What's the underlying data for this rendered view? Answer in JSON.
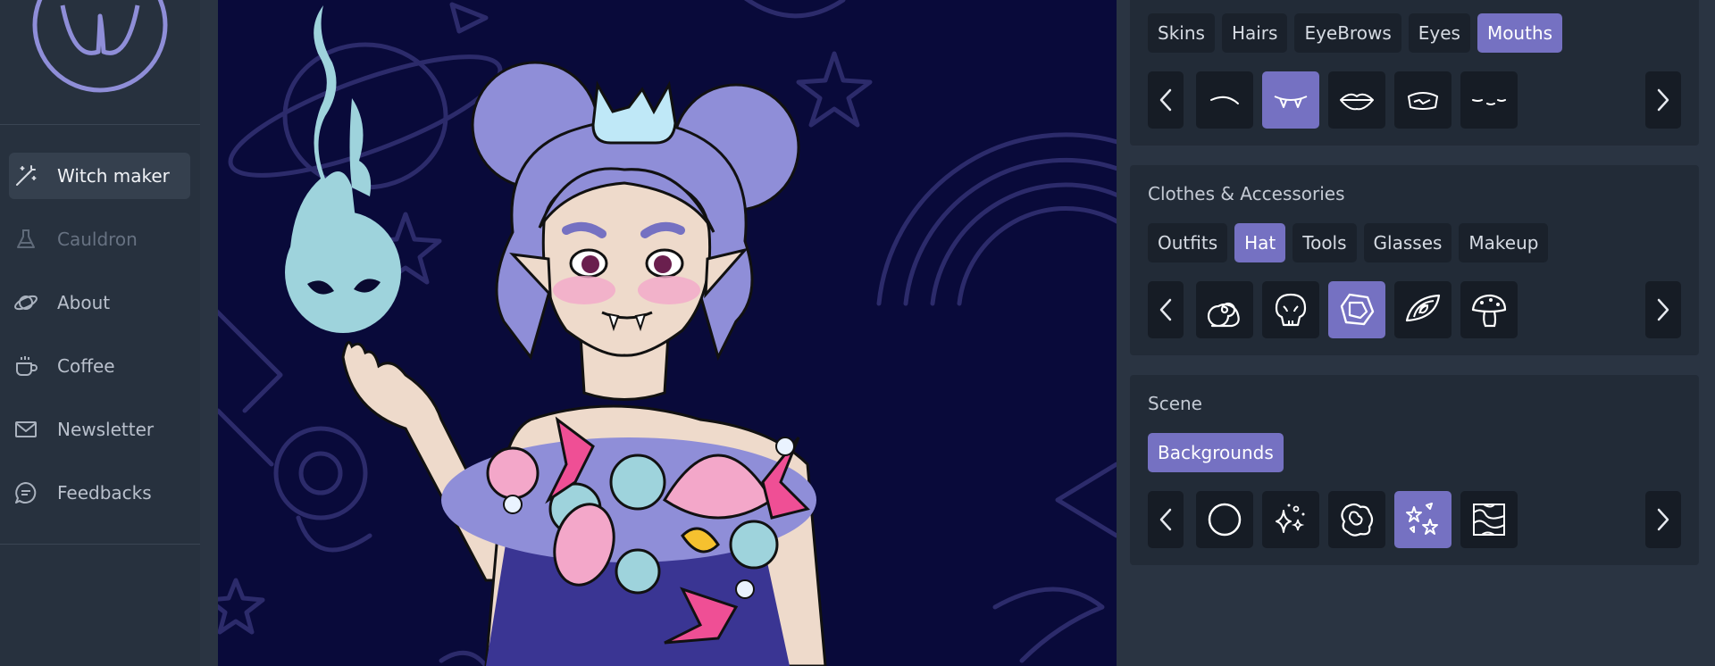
{
  "sidebar": {
    "items": [
      {
        "label": "Witch maker",
        "icon": "magic-wand-icon",
        "state": "active"
      },
      {
        "label": "Cauldron",
        "icon": "flask-icon",
        "state": "disabled"
      },
      {
        "label": "About",
        "icon": "planet-icon",
        "state": "normal"
      },
      {
        "label": "Coffee",
        "icon": "coffee-cup-icon",
        "state": "normal"
      },
      {
        "label": "Newsletter",
        "icon": "envelope-icon",
        "state": "normal"
      },
      {
        "label": "Feedbacks",
        "icon": "chat-bubble-icon",
        "state": "normal"
      }
    ]
  },
  "face": {
    "tabs": [
      "Skins",
      "Hairs",
      "EyeBrows",
      "Eyes",
      "Mouths"
    ],
    "active_tab": "Mouths",
    "items": [
      "mouth-smile-icon",
      "mouth-fangs-icon",
      "mouth-lips-icon",
      "mouth-open-icon",
      "mouth-smirk-icon"
    ],
    "selected_item": "mouth-fangs-icon"
  },
  "clothes": {
    "title": "Clothes & Accessories",
    "tabs": [
      "Outfits",
      "Hat",
      "Tools",
      "Glasses",
      "Makeup"
    ],
    "active_tab": "Hat",
    "items": [
      "snail-shell-icon",
      "skull-icon",
      "crystal-gem-icon",
      "eye-leaf-icon",
      "mushroom-icon"
    ],
    "selected_item": "crystal-gem-icon"
  },
  "scene": {
    "title": "Scene",
    "tabs": [
      "Backgrounds"
    ],
    "active_tab": "Backgrounds",
    "items": [
      "circle-icon",
      "sparkles-icon",
      "blob-icon",
      "stars-icon",
      "waves-icon"
    ],
    "selected_item": "stars-icon"
  },
  "colors": {
    "accent": "#7571c2",
    "canvas": "#090a3a",
    "hair": "#8f8ed8",
    "spirit": "#9ed3dc",
    "skin": "#eedacb"
  }
}
